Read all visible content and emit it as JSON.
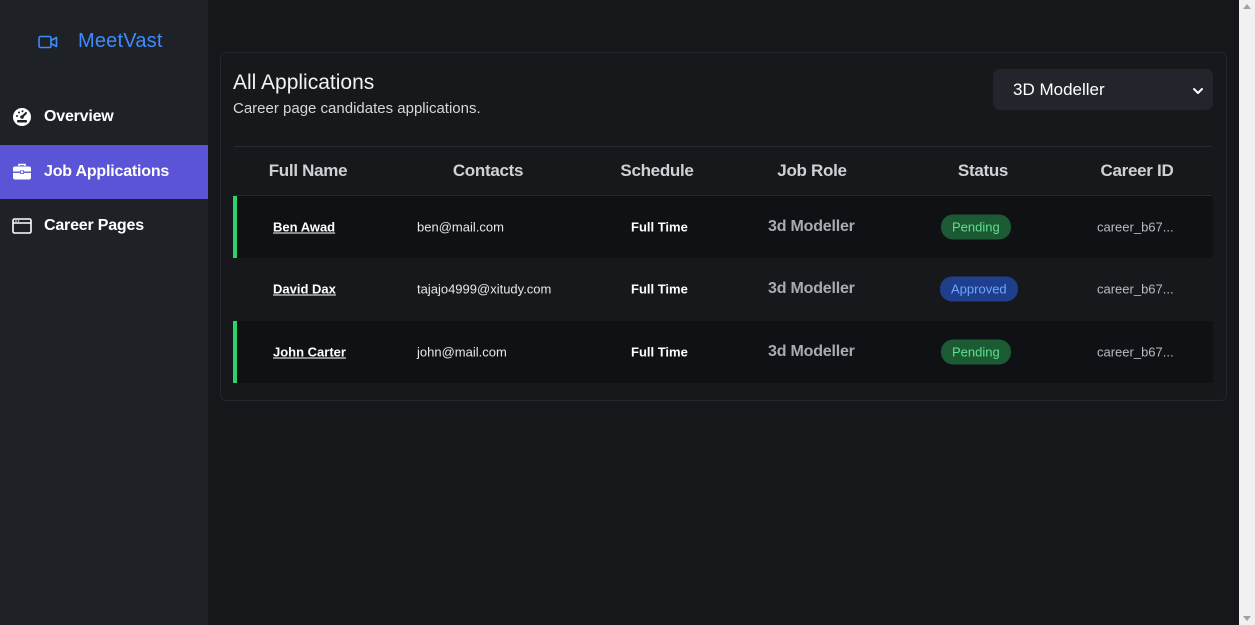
{
  "brand": {
    "name": "MeetVast",
    "icon": "video-camera-icon",
    "color": "#3d8bfd"
  },
  "sidebar": {
    "items": [
      {
        "label": "Overview",
        "icon": "dashboard-gauge-icon",
        "active": false
      },
      {
        "label": "Job Applications",
        "icon": "briefcase-icon",
        "active": true
      },
      {
        "label": "Career Pages",
        "icon": "browser-window-icon",
        "active": false
      }
    ],
    "active_color": "#5b54d6"
  },
  "main": {
    "title": "All Applications",
    "subtitle": "Career page candidates applications.",
    "role_filter": {
      "selected": "3D Modeller"
    },
    "table": {
      "headers": [
        "Full Name",
        "Contacts",
        "Schedule",
        "Job Role",
        "Status",
        "Career ID"
      ],
      "rows": [
        {
          "name": "Ben Awad",
          "contact": "ben@mail.com",
          "schedule": "Full Time",
          "job_role": "3d Modeller",
          "status": "Pending",
          "career_id": "career_b67...",
          "highlight": true
        },
        {
          "name": "David Dax",
          "contact": "tajajo4999@xitudy.com",
          "schedule": "Full Time",
          "job_role": "3d Modeller",
          "status": "Approved",
          "career_id": "career_b67...",
          "highlight": false
        },
        {
          "name": "John Carter",
          "contact": "john@mail.com",
          "schedule": "Full Time",
          "job_role": "3d Modeller",
          "status": "Pending",
          "career_id": "career_b67...",
          "highlight": true
        }
      ]
    },
    "status_colors": {
      "pending": "#5fe08f",
      "approved": "#6ea6ff",
      "accent": "#2bd46b"
    }
  }
}
